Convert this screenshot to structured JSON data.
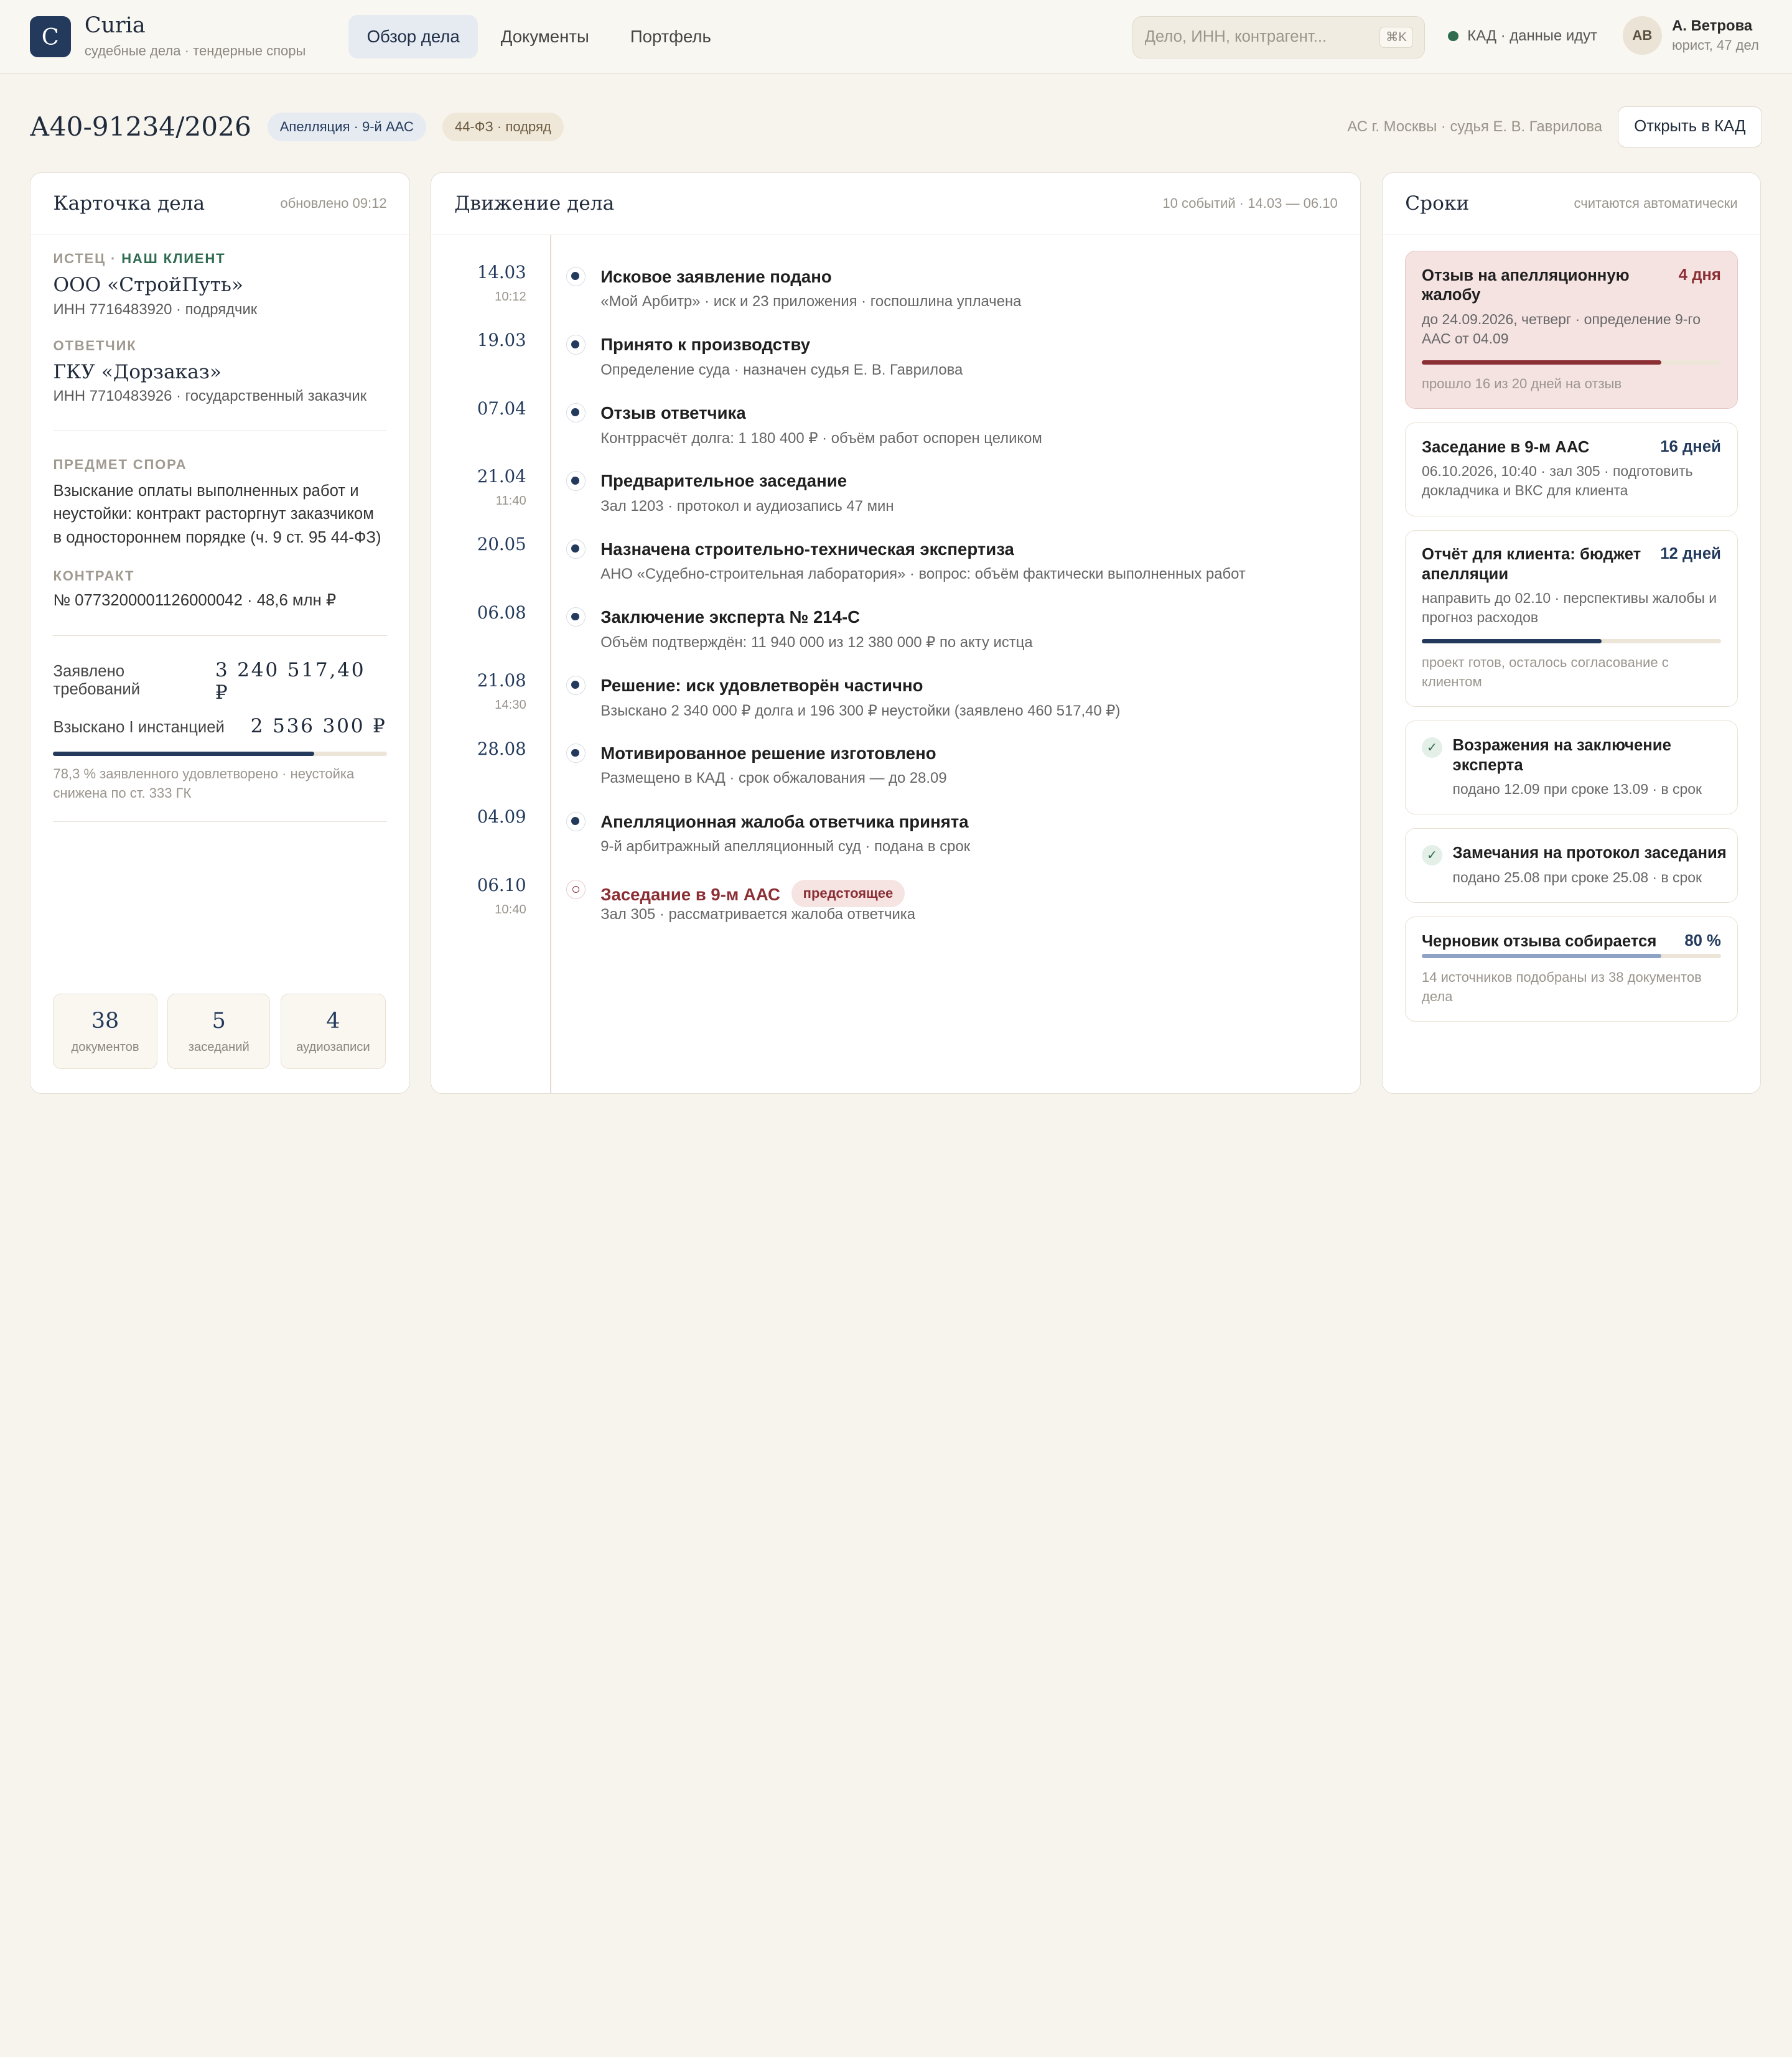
{
  "app": {
    "logo_letter": "C",
    "name": "Curia",
    "subtitle": "судебные дела · тендерные споры"
  },
  "nav": {
    "tabs": [
      {
        "label": "Обзор дела",
        "active": true
      },
      {
        "label": "Документы",
        "active": false
      },
      {
        "label": "Портфель",
        "active": false
      }
    ]
  },
  "search": {
    "placeholder": "Дело, ИНН, контрагент...",
    "shortcut": "⌘K"
  },
  "status": {
    "text": "КАД · данные идут",
    "color": "#2f6b4f"
  },
  "user": {
    "initials": "АВ",
    "name": "А. Ветрова",
    "role": "юрист, 47 дел"
  },
  "case": {
    "number": "А40-91234/2026",
    "tag_stage": "Апелляция · 9-й ААС",
    "tag_law": "44-ФЗ · подряд",
    "court": "АС г. Москвы · судья Е. В. Гаврилова",
    "open_button": "Открыть в КАД"
  },
  "card": {
    "title": "Карточка дела",
    "updated": "обновлено 09:12",
    "plaintiff_role": "ИСТЕЦ · ",
    "plaintiff_client": "НАШ КЛИЕНТ",
    "plaintiff_name": "ООО «СтройПуть»",
    "plaintiff_inn": "ИНН 7716483920 · подрядчик",
    "defendant_role": "ОТВЕТЧИК",
    "defendant_name": "ГКУ «Дорзаказ»",
    "defendant_inn": "ИНН 7710483926 · государственный заказчик",
    "subject_label": "ПРЕДМЕТ СПОРА",
    "subject_text": "Взыскание оплаты выполненных работ и неустойки: контракт расторгнут заказчиком в одностороннем порядке (ч. 9 ст. 95 44-ФЗ)",
    "contract_label": "КОНТРАКТ",
    "contract_text": "№ 0773200001126000042 · 48,6 млн ₽",
    "claimed_label": "Заявлено требований",
    "claimed_value": "3 240 517,40 ₽",
    "awarded_label": "Взыскано I инстанцией",
    "awarded_value": "2 536 300 ₽",
    "awarded_fraction": 0.783,
    "awarded_note": "78,3 % заявленного удовлетворено · неустойка снижена по ст. 333 ГК",
    "stats": [
      {
        "n": "38",
        "label": "документов"
      },
      {
        "n": "5",
        "label": "заседаний"
      },
      {
        "n": "4",
        "label": "аудиозаписи"
      }
    ]
  },
  "timeline": {
    "title": "Движение дела",
    "meta": "10 событий · 14.03 — 06.10",
    "upcoming_badge": "предстоящее",
    "events": [
      {
        "date": "14.03",
        "time": "10:12",
        "title": "Исковое заявление подано",
        "sub": "«Мой Арбитр» · иск и 23 приложения · госпошлина уплачена"
      },
      {
        "date": "19.03",
        "time": "",
        "title": "Принято к производству",
        "sub": "Определение суда · назначен судья Е. В. Гаврилова"
      },
      {
        "date": "07.04",
        "time": "",
        "title": "Отзыв ответчика",
        "sub": "Контррасчёт долга: 1 180 400 ₽ · объём работ оспорен целиком"
      },
      {
        "date": "21.04",
        "time": "11:40",
        "title": "Предварительное заседание",
        "sub": "Зал 1203 · протокол и аудиозапись 47 мин"
      },
      {
        "date": "20.05",
        "time": "",
        "title": "Назначена строительно-техническая экспертиза",
        "sub": "АНО «Судебно-строительная лаборатория» · вопрос: объём фактически выполненных работ"
      },
      {
        "date": "06.08",
        "time": "",
        "title": "Заключение эксперта № 214-С",
        "sub": "Объём подтверждён: 11 940 000 из 12 380 000 ₽ по акту истца"
      },
      {
        "date": "21.08",
        "time": "14:30",
        "title": "Решение: иск удовлетворён частично",
        "sub": "Взыскано 2 340 000 ₽ долга и 196 300 ₽ неустойки (заявлено 460 517,40 ₽)"
      },
      {
        "date": "28.08",
        "time": "",
        "title": "Мотивированное решение изготовлено",
        "sub": "Размещено в КАД · срок обжалования — до 28.09"
      },
      {
        "date": "04.09",
        "time": "",
        "title": "Апелляционная жалоба ответчика принята",
        "sub": "9-й арбитражный апелляционный суд · подана в срок"
      },
      {
        "date": "06.10",
        "time": "10:40",
        "title": "Заседание в 9-м ААС",
        "sub": "Зал 305 · рассматривается жалоба ответчика"
      }
    ]
  },
  "deadlines": {
    "title": "Сроки",
    "meta": "считаются автоматически",
    "items": [
      {
        "title": "Отзыв на апелляционную жалобу",
        "days": "4 дня",
        "desc": "до 24.09.2026, четверг · определение 9-го ААС от 04.09",
        "progress": 0.8,
        "note": "прошло 16 из 20 дней на отзыв",
        "color": "#8b2f35"
      },
      {
        "title": "Заседание в 9-м ААС",
        "days": "16 дней",
        "desc": "06.10.2026, 10:40 · зал 305 · подготовить докладчика и ВКС для клиента"
      },
      {
        "title": "Отчёт для клиента: бюджет апелляции",
        "days": "12 дней",
        "desc": "направить до 02.10 · перспективы жалобы и прогноз расходов",
        "progress": 0.6,
        "note": "проект готов, осталось согласование с клиентом",
        "color": "#233a5c"
      },
      {
        "title": "Возражения на заключение эксперта",
        "desc": "подано 12.09 при сроке 13.09 · в срок"
      },
      {
        "title": "Замечания на протокол заседания",
        "desc": "подано 25.08 при сроке 25.08 · в срок"
      },
      {
        "title": "Черновик отзыва собирается",
        "days": "80 %",
        "progress": 0.8,
        "note": "14 источников подобраны из 38 документов дела",
        "color": "#8fa3c4"
      }
    ]
  }
}
